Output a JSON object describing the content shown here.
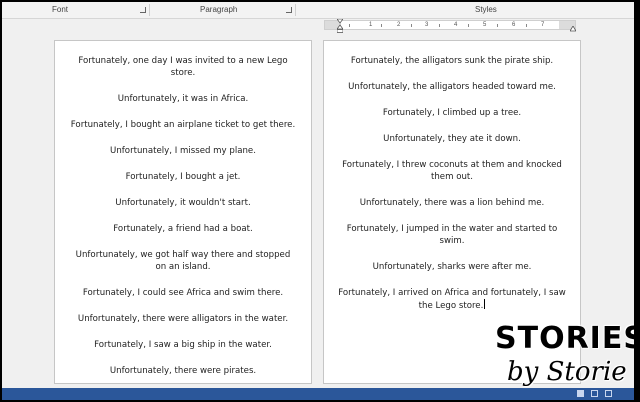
{
  "ribbon": {
    "font_label": "Font",
    "paragraph_label": "Paragraph",
    "styles_label": "Styles"
  },
  "ruler": {
    "numbers": [
      "1",
      "2",
      "3",
      "4",
      "5",
      "6",
      "7"
    ]
  },
  "document": {
    "left_page": [
      "Fortunately, one day I was invited to a new Lego store.",
      "Unfortunately, it was in Africa.",
      "Fortunately, I bought an airplane ticket to get there.",
      "Unfortunately, I missed my plane.",
      "Fortunately, I bought a jet.",
      "Unfortunately, it wouldn't start.",
      "Fortunately, a friend had a boat.",
      "Unfortunately, we got half way there and stopped on an island.",
      "Fortunately, I could see Africa and swim there.",
      "Unfortunately, there were alligators in the water.",
      "Fortunately, I saw a big ship in the water.",
      "Unfortunately, there were pirates."
    ],
    "right_page": [
      "Fortunately, the alligators sunk the pirate ship.",
      "Unfortunately, the alligators headed toward me.",
      "Fortunately, I climbed up a tree.",
      "Unfortunately, they ate it down.",
      "Fortunately, I threw coconuts at them and knocked them out.",
      "Unfortunately, there was a lion behind me.",
      "Fortunately, I jumped in the water and started to swim.",
      "Unfortunately, sharks were after me.",
      "Fortunately, I arrived on Africa and fortunately, I saw the Lego store."
    ]
  },
  "logo": {
    "line1": "STORIES",
    "line2": "by Storie"
  },
  "colors": {
    "status_bar": "#2b579a",
    "page_background": "#ffffff",
    "app_background": "#f0f0f0"
  }
}
